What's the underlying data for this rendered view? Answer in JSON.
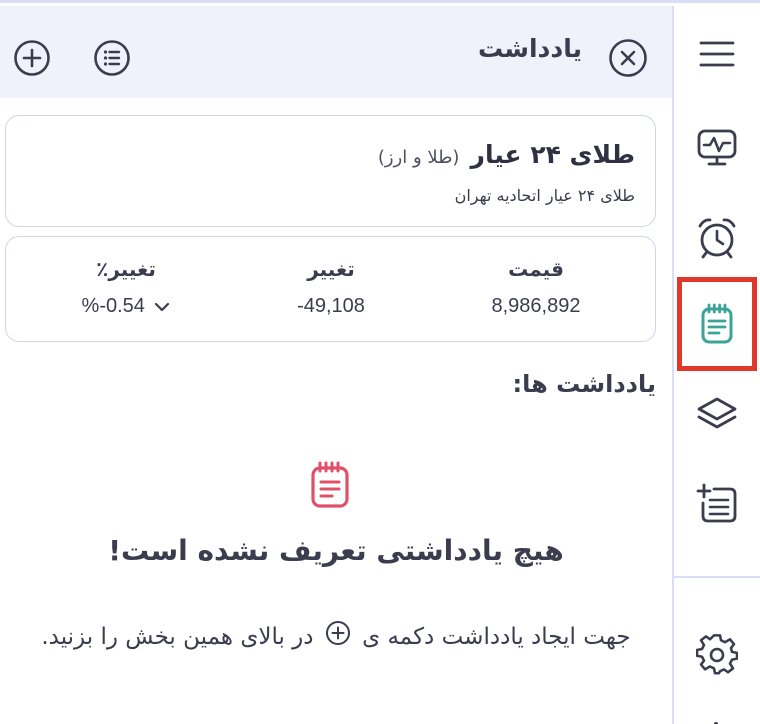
{
  "header": {
    "title": "یادداشت",
    "close_icon": "close-circle-icon",
    "list_icon": "list-circle-icon",
    "add_icon": "plus-circle-icon"
  },
  "asset": {
    "name": "طلای ۲۴ عیار",
    "category": "(طلا و ارز)",
    "subtitle": "طلای ۲۴ عیار اتحادیه تهران"
  },
  "stats": {
    "price_label": "قیمت",
    "price_value": "8,986,892",
    "change_label": "تغییر",
    "change_value": "-49,108",
    "percent_label": "تغییر٪",
    "percent_value": "%-0.54"
  },
  "notes": {
    "heading": "یادداشت ها:",
    "empty_title": "هیچ یادداشتی تعریف نشده است!",
    "hint_before": "جهت ایجاد یادداشت دکمه ی",
    "hint_after": "در بالای همین بخش را بزنید."
  },
  "sidebar": {
    "items": [
      {
        "name": "menu-icon"
      },
      {
        "name": "monitor-chart-icon"
      },
      {
        "name": "alarm-clock-icon"
      },
      {
        "name": "notepad-icon",
        "active": true
      },
      {
        "name": "layers-icon"
      },
      {
        "name": "add-list-icon"
      },
      {
        "name": "gear-icon"
      }
    ]
  },
  "colors": {
    "accent_red": "#e0392c",
    "active_icon": "#3aa39a",
    "empty_icon": "#e0506a",
    "header_bg": "#f0f2fb"
  }
}
